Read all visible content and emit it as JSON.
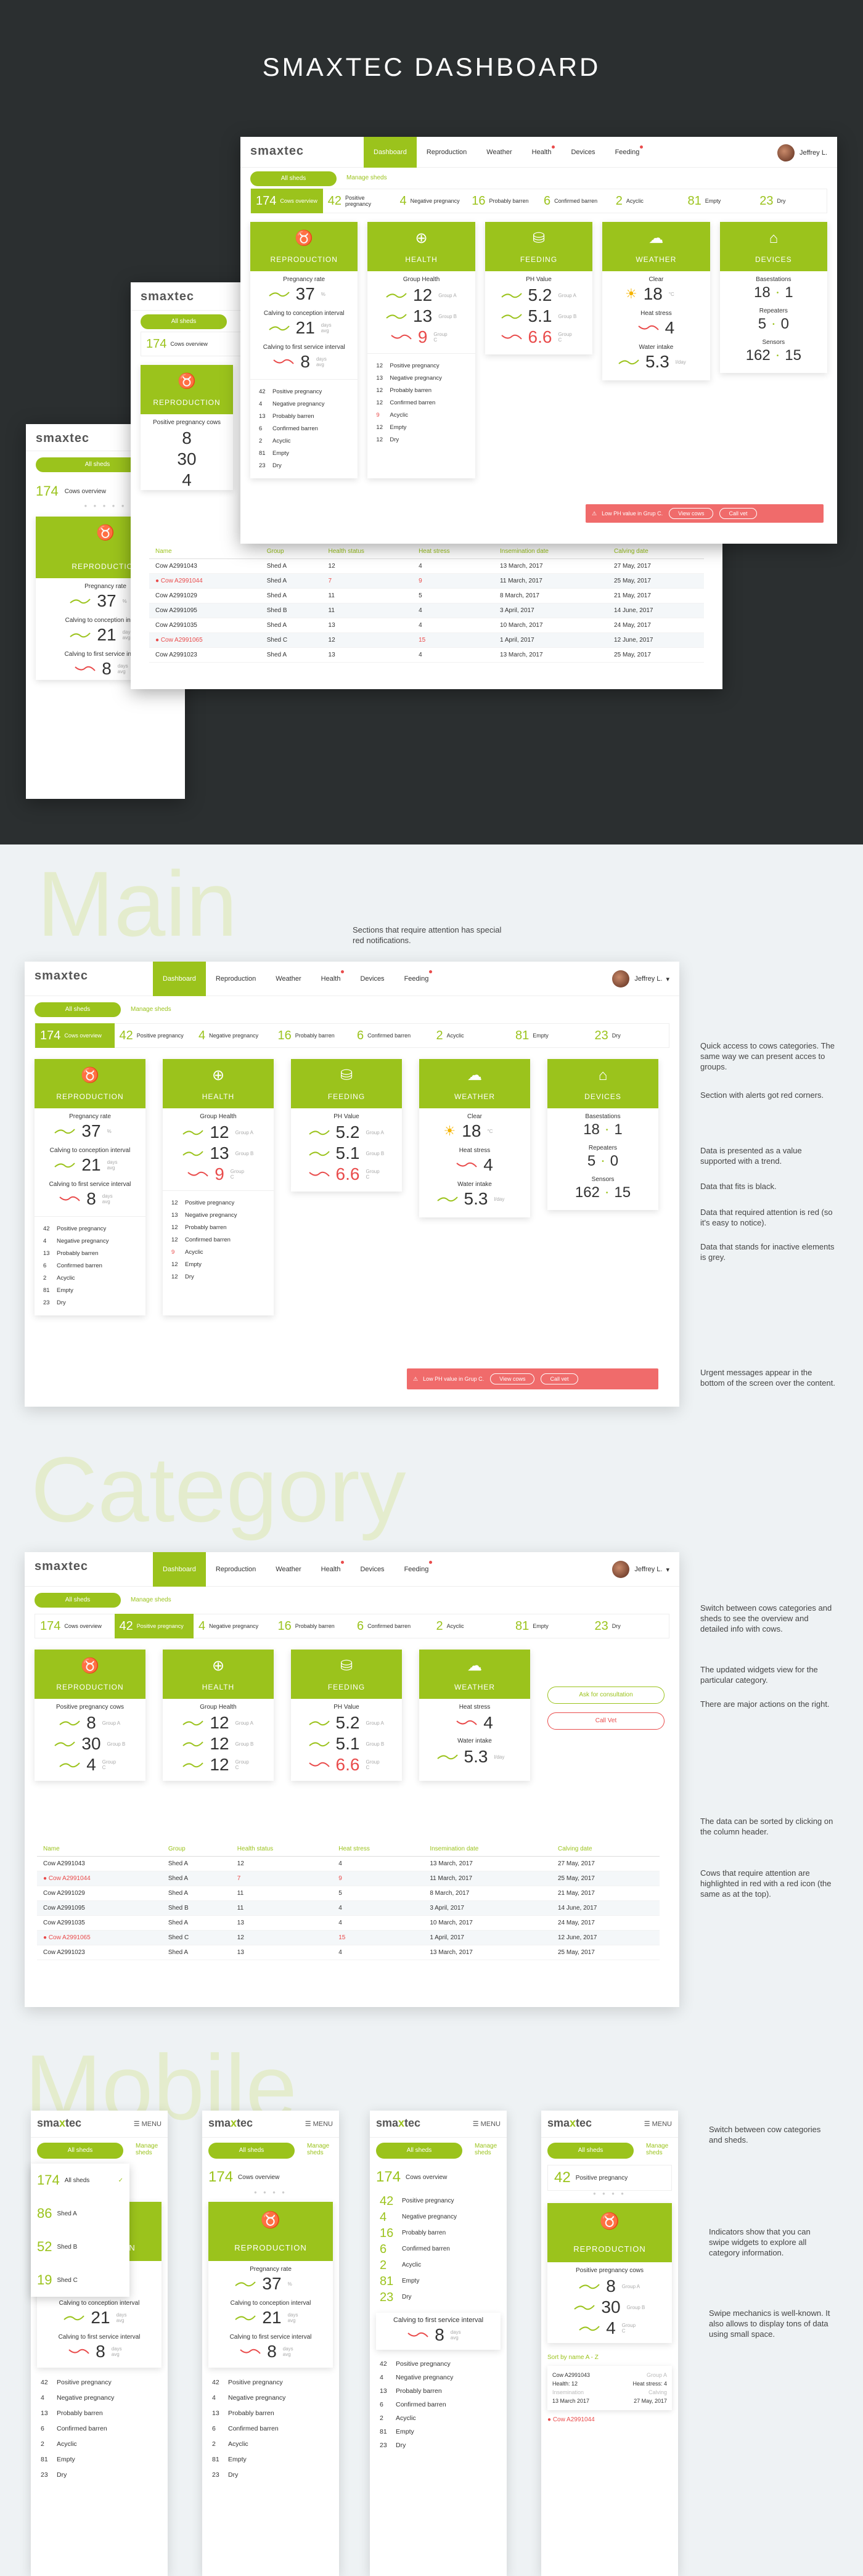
{
  "hero": {
    "title": "SMAXTEC DASHBOARD"
  },
  "app": {
    "logo": "smaxtec",
    "logo_sub": "animal care",
    "nav": [
      "Dashboard",
      "Reproduction",
      "Weather",
      "Health",
      "Devices",
      "Feeding"
    ],
    "user": "Jeffrey L.",
    "filter": "All sheds",
    "manage": "Manage sheds"
  },
  "categories": [
    {
      "n": "174",
      "l": "Cows overview"
    },
    {
      "n": "42",
      "l": "Positive pregnancy"
    },
    {
      "n": "4",
      "l": "Negative pregnancy"
    },
    {
      "n": "16",
      "l": "Probably barren"
    },
    {
      "n": "6",
      "l": "Confirmed barren"
    },
    {
      "n": "2",
      "l": "Acyclic"
    },
    {
      "n": "81",
      "l": "Empty"
    },
    {
      "n": "23",
      "l": "Dry"
    }
  ],
  "widgets": {
    "reproduction": {
      "title": "REPRODUCTION",
      "m1": {
        "label": "Pregnancy rate",
        "value": "37",
        "unit": "%"
      },
      "m2": {
        "label": "Calving to conception interval",
        "value": "21",
        "unit": "days avg"
      },
      "m3": {
        "label": "Calving to first service interval",
        "value": "8",
        "unit": "days avg"
      },
      "list": [
        [
          "42",
          "Positive pregnancy"
        ],
        [
          "4",
          "Negative pregnancy"
        ],
        [
          "13",
          "Probably barren"
        ],
        [
          "6",
          "Confirmed barren"
        ],
        [
          "2",
          "Acyclic"
        ],
        [
          "81",
          "Empty"
        ],
        [
          "23",
          "Dry"
        ]
      ]
    },
    "health": {
      "title": "HEALTH",
      "label": "Group Health",
      "values": [
        "12",
        "13",
        "9"
      ],
      "groups": [
        "Group A",
        "Group B",
        "Group C"
      ],
      "list": [
        [
          "12",
          "Positive pregnancy"
        ],
        [
          "13",
          "Negative pregnancy"
        ],
        [
          "12",
          "Probably barren"
        ],
        [
          "12",
          "Confirmed barren"
        ],
        [
          "9",
          "Acyclic"
        ],
        [
          "12",
          "Empty"
        ],
        [
          "12",
          "Dry"
        ]
      ]
    },
    "feeding": {
      "title": "FEEDING",
      "label": "PH Value",
      "values": [
        "5.2",
        "5.1",
        "6.6"
      ]
    },
    "weather": {
      "title": "WEATHER",
      "clear": "Clear",
      "temp": "18",
      "temp_unit": "°C",
      "heat": "Heat stress",
      "heat_v": "4",
      "water": "Water intake",
      "water_v": "5.3",
      "water_u": "l/day"
    },
    "devices": {
      "title": "DEVICES",
      "bs": "Basestations",
      "bs_v": "18",
      "bs_i": "1",
      "rp": "Repeaters",
      "rp_v": "5",
      "rp_i": "0",
      "sn": "Sensors",
      "sn_v": "162",
      "sn_i": "15"
    }
  },
  "alert": {
    "text": "Low PH value in Grup C.",
    "btn1": "View cows",
    "btn2": "Call vet"
  },
  "category_view": {
    "pcows": "Positive pregnancy cows",
    "pvalues": [
      "8",
      "30",
      "4"
    ],
    "ask": "Ask for consultation",
    "callvet": "Call Vet"
  },
  "table": {
    "headers": [
      "Name",
      "Group",
      "Health status",
      "Heat stress",
      "Insemination date",
      "Calving date"
    ],
    "rows": [
      [
        "Cow A2991043",
        "Shed A",
        "12",
        "4",
        "13 March, 2017",
        "27 May, 2017"
      ],
      [
        "Cow A2991044",
        "Shed A",
        "7",
        "9",
        "11 March, 2017",
        "25 May, 2017"
      ],
      [
        "Cow A2991029",
        "Shed A",
        "11",
        "5",
        "8 March, 2017",
        "21 May, 2017"
      ],
      [
        "Cow A2991095",
        "Shed B",
        "11",
        "4",
        "3 April, 2017",
        "14 June, 2017"
      ],
      [
        "Cow A2991035",
        "Shed A",
        "13",
        "4",
        "10 March, 2017",
        "24 May, 2017"
      ],
      [
        "Cow A2991065",
        "Shed C",
        "12",
        "15",
        "1 April, 2017",
        "12 June, 2017"
      ],
      [
        "Cow A2991023",
        "Shed A",
        "13",
        "4",
        "13 March, 2017",
        "25 May, 2017"
      ]
    ]
  },
  "sections": {
    "main": {
      "word": "Main",
      "intro": "Sections that require attention has special red notifications.",
      "notes": [
        "Quick access to cows categories. The same way we can present acces to groups.",
        "Section with alerts got red corners.",
        "Data is presented as a value supported with a trend.",
        "Data that fits is black.",
        "Data that required attention is red (so it's easy to notice).",
        "Data that stands for inactive elements is grey.",
        "Urgent messages appear in the bottom of the screen over the content."
      ]
    },
    "category": {
      "word": "Category",
      "notes": [
        "Switch between cows categories and sheds to see the overview and detailed info with cows.",
        "The updated widgets view for the particular category.",
        "There are major actions on the right.",
        "The data can be sorted by clicking on the column header.",
        "Cows that require attention are highlighted in red with a red icon (the same as at the top)."
      ]
    },
    "mobile": {
      "word": "Mobile",
      "menu": "MENU",
      "sheds": [
        [
          "174",
          "All sheds"
        ],
        [
          "86",
          "Shed A"
        ],
        [
          "52",
          "Shed B"
        ],
        [
          "19",
          "Shed C"
        ]
      ],
      "sort": "Sort by name A - Z",
      "card": {
        "name": "Cow A2991043",
        "group": "Group A",
        "health": "Health: 12",
        "heat": "Heat stress: 4",
        "ins_l": "Insemination",
        "ins": "13 March 2017",
        "calv_l": "Calving",
        "calv": "27 May, 2017"
      },
      "card2": "Cow A2991044",
      "notes": [
        "Switch between cow categories and sheds.",
        "Indicators show that you can swipe widgets to explore all category information.",
        "Swipe mechanics is well-known. It also allows to display tons of data using small space."
      ]
    }
  },
  "colors": {
    "accent": "#9bc31c",
    "alert": "#e94b4b",
    "dark": "#2b2f30"
  },
  "icons": [
    "cow-icon",
    "health-icon",
    "feeding-icon",
    "weather-icon",
    "devices-icon",
    "alert-icon",
    "menu-icon",
    "check-icon"
  ]
}
